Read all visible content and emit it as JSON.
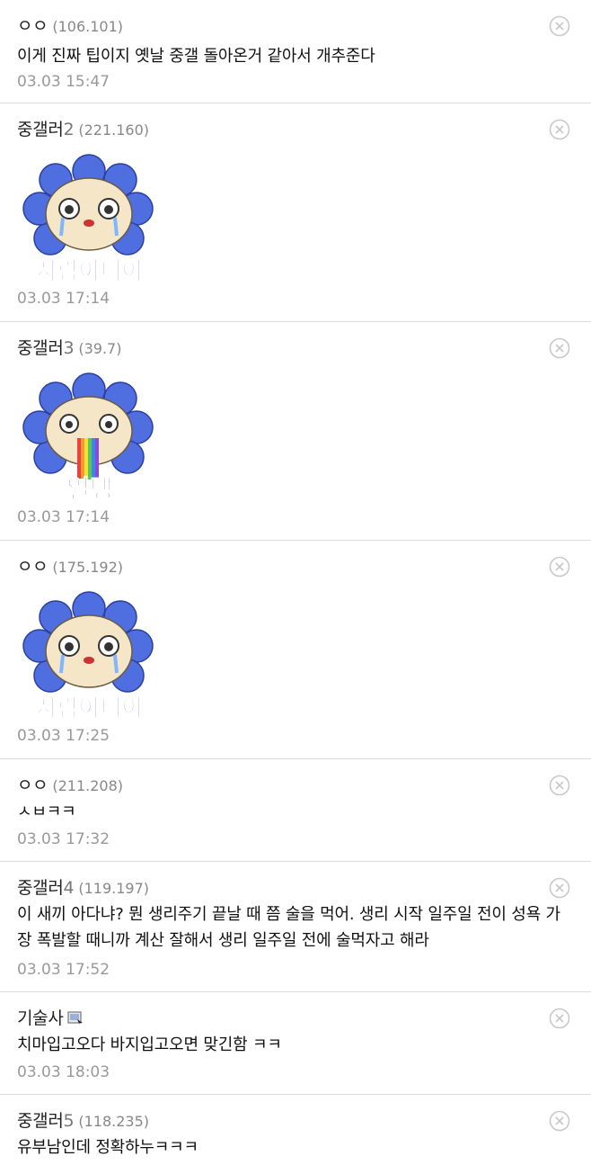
{
  "comments": [
    {
      "nick": "ㅇㅇ",
      "nick_num": "",
      "ip": "(106.101)",
      "text": "이게 진짜 팁이지 옛날 중갤 돌아온거 같아서 개추준다",
      "date": "03.03 15:47"
    },
    {
      "nick": "중갤러",
      "nick_num": "2",
      "ip": "(221.160)",
      "sticker": "sticker-crying-flower",
      "sticker_text": "사람아니야",
      "date": "03.03 17:14"
    },
    {
      "nick": "중갤러",
      "nick_num": "3",
      "ip": "(39.7)",
      "sticker": "sticker-rainbow-flower",
      "sticker_text": "열탱",
      "date": "03.03 17:14"
    },
    {
      "nick": "ㅇㅇ",
      "nick_num": "",
      "ip": "(175.192)",
      "sticker": "sticker-crying-flower",
      "sticker_text": "사람아니야",
      "date": "03.03 17:25"
    },
    {
      "nick": "ㅇㅇ",
      "nick_num": "",
      "ip": "(211.208)",
      "text": "ㅅㅂㅋㅋ",
      "date": "03.03 17:32"
    },
    {
      "nick": "중갤러",
      "nick_num": "4",
      "ip": "(119.197)",
      "text": "이 새끼 아다냐? 뭔 생리주기 끝날 때 쯤 술을 먹어. 생리 시작 일주일 전이 성욕 가장 폭발할 때니까 계산 잘해서 생리 일주일 전에 술먹자고 해라",
      "date": "03.03 17:52"
    },
    {
      "nick": "기술사",
      "nick_num": "",
      "ip": "",
      "badge": "gallery-member-icon",
      "text": "치마입고오다 바지입고오면 맞긴함 ㅋㅋ",
      "date": "03.03 18:03"
    },
    {
      "nick": "중갤러",
      "nick_num": "5",
      "ip": "(118.235)",
      "text": "유부남인데 정확하누ㅋㅋㅋ",
      "date": ""
    }
  ],
  "colors": {
    "flower": "#4f6fe0",
    "face": "#f5e6c8",
    "sticker_text": "#6a3fd0",
    "rainbow": [
      "#e94040",
      "#f49a2a",
      "#f1e03a",
      "#5cc45a",
      "#3a8be0",
      "#8a4ad8"
    ]
  }
}
